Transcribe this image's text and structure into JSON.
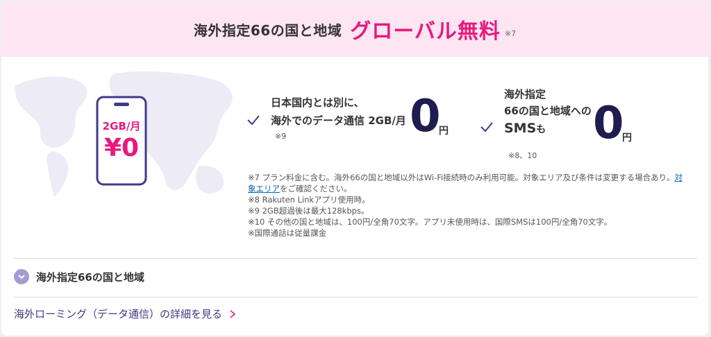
{
  "header": {
    "prefix": "海外指定66の国と地域",
    "highlight": "グローバル無料",
    "note": "※7"
  },
  "phone": {
    "line1": "2GB/月",
    "line2": "¥0"
  },
  "feature1": {
    "line1": "日本国内とは別に、",
    "line2": "海外でのデータ通信 2GB/月",
    "value": "0",
    "unit": "円",
    "note": "※9"
  },
  "feature2": {
    "line1": "海外指定",
    "line2": "66の国と地域への",
    "sms": "SMS",
    "mo": "も",
    "value": "0",
    "unit": "円",
    "note": "※8、10"
  },
  "notes": {
    "n7_a": "※7 プラン料金に含む。海外66の国と地域以外はWi-Fi接続時のみ利用可能。対象エリア及び条件は変更する場合あり。",
    "n7_link1": "対",
    "n7_link2": "象エリア",
    "n7_b": "をご確認ください。",
    "n8": "※8 Rakuten Linkアプリ使用時。",
    "n9": "※9 2GB超過後は最大128kbps。",
    "n10": "※10 その他の国と地域は、100円/全角70文字。アプリ未使用時は、国際SMSは100円/全角70文字。",
    "n11": "※国際通話は従量課金"
  },
  "accordion": {
    "label": "海外指定66の国と地域"
  },
  "details_link": {
    "label": "海外ローミング（データ通信）の詳細を見る"
  },
  "colors": {
    "header_bg": "#fde6f1",
    "brand_pink": "#e8197f",
    "navy": "#1f1d4f",
    "phone_frame": "#3f3a8c",
    "accent_purple": "#a39cd3"
  },
  "icons": [
    "check-icon",
    "chevron-down-icon",
    "chevron-right-icon",
    "phone-illustration",
    "world-map-illustration"
  ]
}
